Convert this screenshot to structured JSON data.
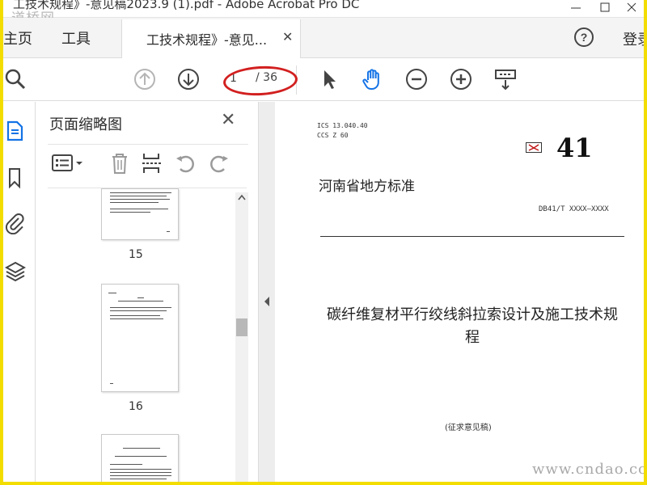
{
  "window": {
    "title": "工技术规程》-意见稿2023.9 (1).pdf - Adobe Acrobat Pro DC",
    "watermark_top": "道桥网"
  },
  "tabs": {
    "home": "主页",
    "tools": "工具",
    "document_tab": "工技术规程》-意见...",
    "document_tab_close": "✕",
    "sign_in": "登录"
  },
  "toolbar": {
    "current_page": "1",
    "total_pages": "/ 36",
    "icons": [
      "search-icon",
      "page-up-icon",
      "page-down-icon",
      "select-arrow-icon",
      "hand-icon",
      "zoom-out-icon",
      "zoom-in-icon",
      "fit-width-icon"
    ],
    "accent_color": "#1473e6",
    "highlight_color": "#d21f1f"
  },
  "panel": {
    "title": "页面缩略图",
    "close": "✕",
    "thumbnails": [
      {
        "page": "15"
      },
      {
        "page": "16"
      }
    ]
  },
  "document": {
    "ics": "ICS  13.040.40",
    "ccs": "CCS  Z 60",
    "db_number": "41",
    "standard_type": "河南省地方标准",
    "standard_code": "DB41/T XXXX—XXXX",
    "title": "碳纤维复材平行绞线斜拉索设计及施工技术规程",
    "draft_note": "(征求意见稿)"
  },
  "watermark_bottom": "www.cndao.com"
}
